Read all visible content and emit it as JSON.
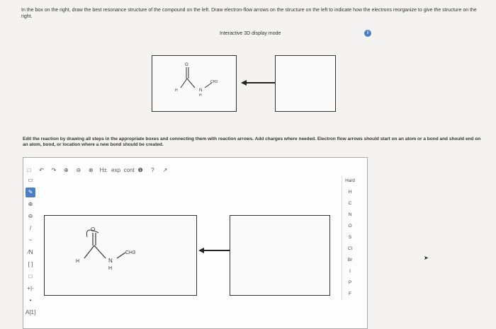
{
  "instructions": "In the box on the right, draw the best resonance structure of the compound on the left. Draw electron-flow arrows on the structure on the left to indicate how the electrons reorganize to give the structure on the right.",
  "display_mode_label": "Interactive 3D display mode",
  "info_icon_glyph": "i",
  "molecule_top": {
    "o": "O",
    "h": "H",
    "n": "N",
    "nh": "H",
    "ch3": "CH3"
  },
  "edit_instructions": "Edit the reaction by drawing all steps in the appropriate boxes and connecting them with reaction arrows. Add charges where needed. Electron flow arrows should start on an atom or a bond and should end on an atom, bond, or location where a new bond should be created.",
  "toolbar": {
    "items": [
      "□",
      "↶",
      "↷",
      "⊕",
      "⊖",
      "⊗",
      "H±",
      "exp",
      "cont",
      "❶",
      "?",
      "↗"
    ],
    "colors": {
      "accent": "#4a7fc4"
    }
  },
  "left_tools": [
    "▭",
    "✎",
    "⊕",
    "⊖",
    "/",
    "~",
    "⁄N",
    "[ ]",
    "□",
    "+|-",
    "•",
    "A[1]"
  ],
  "molecule_editor": {
    "o": "O",
    "h": "H",
    "n": "N",
    "nh": "H",
    "ch3": "CH3"
  },
  "elements_header": "Ha/d",
  "elements": [
    "H",
    "C",
    "N",
    "O",
    "S",
    "Cl",
    "Br",
    "I",
    "P",
    "F"
  ]
}
